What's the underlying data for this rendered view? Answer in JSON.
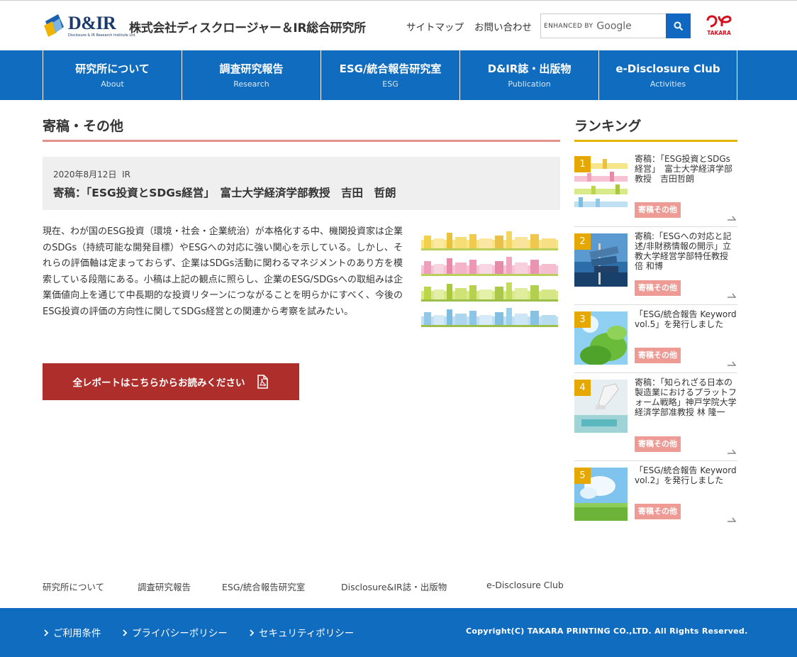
{
  "header": {
    "logo_text": "D&IR",
    "logo_sub": "Disclosure & IR Research Institute Ltd.",
    "company_name": "株式会社ディスクロージャー＆IR総合研究所",
    "sitemap": "サイトマップ",
    "contact": "お問い合わせ",
    "search_enhanced": "ENHANCED BY",
    "search_google": "Google",
    "brand": "TAKARA"
  },
  "nav": [
    {
      "jp": "研究所について",
      "en": "About"
    },
    {
      "jp": "調査研究報告",
      "en": "Research"
    },
    {
      "jp": "ESG/統合報告研究室",
      "en": "ESG"
    },
    {
      "jp": "D&IR誌・出版物",
      "en": "Publication"
    },
    {
      "jp": "e-Disclosure Club",
      "en": "Activities"
    }
  ],
  "main": {
    "section_title": "寄稿・その他",
    "date": "2020年8月12日",
    "category": "IR",
    "article_title": "寄稿：「ESG投資とSDGs経営」　富士大学経済学部教授　吉田　哲朗",
    "body": "現在、わが国のESG投資（環境・社会・企業統治）が本格化する中、機関投資家は企業のSDGs（持続可能な開発目標）やESGへの対応に強い関心を示している。しかし、それらの評価軸は定まっておらず、企業はSDGs活動に関わるマネジメントのあり方を模索している段階にある。小稿は上記の観点に照らし、企業のESG/SDGsへの取組みは企業価値向上を通じて中長期的な投資リターンにつながることを明らかにすべく、今後のESG投資の評価の方向性に関してSDGs経営との関連から考察を試みたい。",
    "report_button": "全レポートはこちらからお読みください"
  },
  "ranking": {
    "title": "ランキング",
    "items": [
      {
        "num": "1",
        "text": "寄稿：「ESG投資とSDGs経営」　富士大学経済学部教授　吉田哲朗",
        "tag": "寄稿その他"
      },
      {
        "num": "2",
        "text": "寄稿:「ESGへの対応と記述/非財務情報の開示」立教大学経営学部特任教授 倍 和博",
        "tag": "寄稿その他"
      },
      {
        "num": "3",
        "text": "「ESG/統合報告 Keyword vol.5」を発行しました",
        "tag": "寄稿その他"
      },
      {
        "num": "4",
        "text": "寄稿：「知られざる日本の製造業におけるプラットフォーム戦略」神戸学院大学 経済学部准教授 林 隆一",
        "tag": "寄稿その他"
      },
      {
        "num": "5",
        "text": "「ESG/統合報告 Keyword vol.2」を発行しました",
        "tag": "寄稿その他"
      }
    ]
  },
  "footer_links": [
    "研究所について",
    "調査研究報告",
    "ESG/統合報告研究室",
    "Disclosure&IR誌・出版物",
    "e-Disclosure Club"
  ],
  "footer": {
    "terms": "ご利用条件",
    "privacy": "プライバシーポリシー",
    "security": "セキュリティポリシー",
    "copyright": "Copyright(C) TAKARA PRINTING CO.,LTD. All Rights Reserved."
  },
  "colors": {
    "nav_blue": "#0f6cbf",
    "accent_red": "#ad2e2a",
    "rank_gold": "#e6a800",
    "tag_pink": "#ed9b94"
  }
}
